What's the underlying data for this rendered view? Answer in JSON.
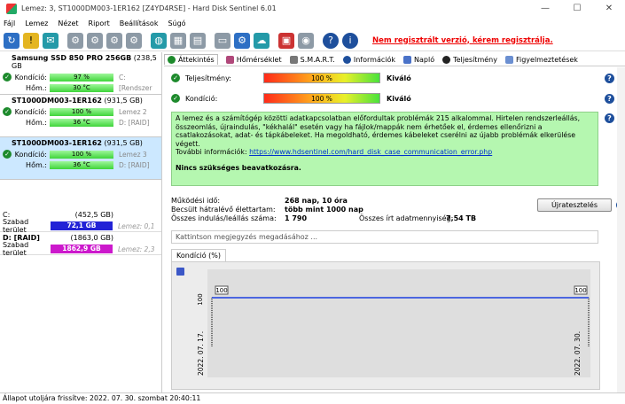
{
  "window": {
    "title": "Lemez: 3, ST1000DM003-1ER162 [Z4YD4RSE]  -  Hard Disk Sentinel 6.01",
    "minimize": "—",
    "maximize": "☐",
    "close": "✕"
  },
  "menu": [
    "Fájl",
    "Lemez",
    "Nézet",
    "Riport",
    "Beállítások",
    "Súgó"
  ],
  "toolbar": {
    "register_link": "Nem regisztrált verzió, kérem regisztrálja."
  },
  "disks": [
    {
      "name": "Samsung SSD 850 PRO 256GB",
      "size": "(238,5 GB",
      "health_label": "Kondíció:",
      "health": "97 %",
      "health_extra": "C:",
      "temp_label": "Hőm.:",
      "temp": "30 °C",
      "temp_extra": "[Rendszer"
    },
    {
      "name": "ST1000DM003-1ER162",
      "size": "(931,5 GB)",
      "health_label": "Kondíció:",
      "health": "100 %",
      "health_extra": "Lemez 2",
      "temp_label": "Hőm.:",
      "temp": "36 °C",
      "temp_extra": "D: [RAID]"
    },
    {
      "name": "ST1000DM003-1ER162",
      "size": "(931,5 GB)",
      "health_label": "Kondíció:",
      "health": "100 %",
      "health_extra": "Lemez 3",
      "temp_label": "Hőm.:",
      "temp": "36 °C",
      "temp_extra": "D: [RAID]"
    }
  ],
  "volumes": [
    {
      "name": "C:",
      "size": "(452,5 GB)",
      "free_label": "Szabad terület",
      "free": "72,1 GB",
      "disk": "Lemez: 0,1",
      "color": "#2323d6"
    },
    {
      "name": "D: [RAID]",
      "size": "(1863,0 GB)",
      "free_label": "Szabad terület",
      "free": "1862,9 GB",
      "disk": "Lemez: 2,3",
      "color": "#cc19cc"
    }
  ],
  "tabs": [
    "Áttekintés",
    "Hőmérséklet",
    "S.M.A.R.T.",
    "Információk",
    "Napló",
    "Teljesítmény",
    "Figyelmeztetések"
  ],
  "status": {
    "performance_label": "Teljesítmény:",
    "performance_value": "100 %",
    "performance_text": "Kiváló",
    "health_label": "Kondíció:",
    "health_value": "100 %",
    "health_text": "Kiváló"
  },
  "message": {
    "text": "A lemez és a számítógép közötti adatkapcsolatban előfordultak problémák 215 alkalommal. Hirtelen rendszerleállás, összeomlás, újraindulás, \"kékhalál\" esetén vagy ha fájlok/mappák nem érhetőek el, érdemes ellenőrizni a csatlakozásokat, adat- és tápkábeleket. Ha megoldható, érdemes kábeleket cserélni az újabb problémák elkerülése végett.",
    "more_label": "További információk: ",
    "link": "https://www.hdsentinel.com/hard_disk_case_communication_error.php",
    "action": "Nincs szükséges beavatkozásra."
  },
  "info": {
    "uptime_label": "Működési idő:",
    "uptime": "268 nap, 10 óra",
    "remaining_label": "Becsült hátralévő élettartam:",
    "remaining": "több mint 1000 nap",
    "starts_label": "Összes indulás/leállás száma:",
    "starts": "1 790",
    "written_label": "Összes írt adatmennyiség:",
    "written": "7,54 TB"
  },
  "reset_button": "Újratesztelés",
  "note_placeholder": "Kattintson megjegyzés megadásához ...",
  "chart_tab": "Kondíció  (%)",
  "chart_data": {
    "type": "line",
    "x": [
      "2022. 07. 17.",
      "2022. 07. 30."
    ],
    "series": [
      {
        "values": [
          100,
          100
        ]
      }
    ],
    "y_tick": "100",
    "point_labels": [
      "100",
      "100"
    ],
    "ylim": [
      0,
      100
    ],
    "color": "#1b3fe0"
  },
  "statusbar": "Állapot utoljára frissítve: 2022. 07. 30. szombat 20:40:11"
}
